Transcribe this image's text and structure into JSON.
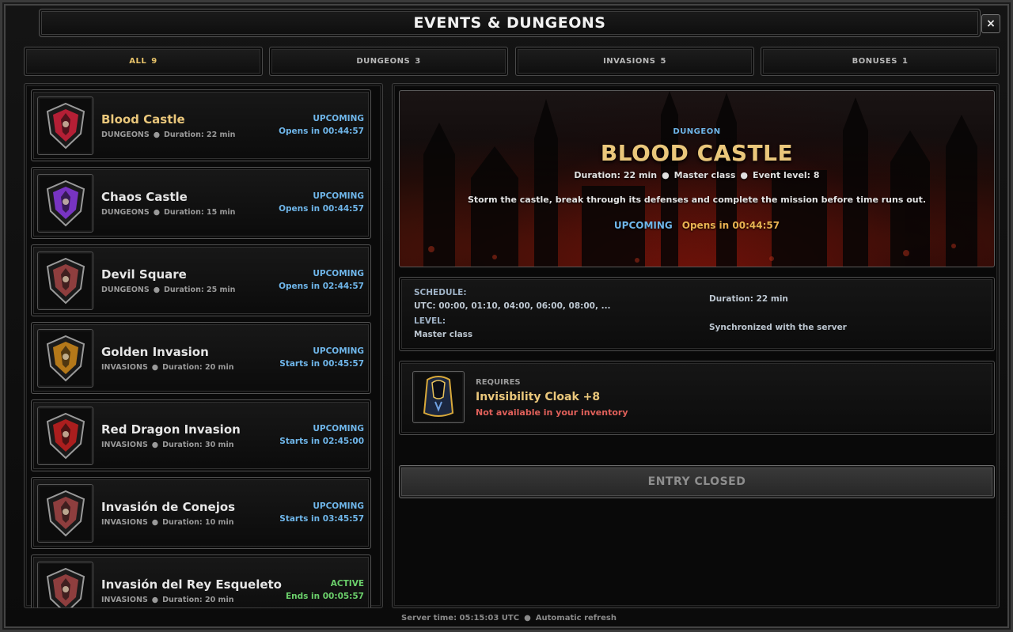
{
  "window": {
    "title": "EVENTS & DUNGEONS",
    "close_label": "×"
  },
  "tabs": [
    {
      "label": "ALL",
      "count": "9",
      "active": true
    },
    {
      "label": "DUNGEONS",
      "count": "3",
      "active": false
    },
    {
      "label": "INVASIONS",
      "count": "5",
      "active": false
    },
    {
      "label": "BONUSES",
      "count": "1",
      "active": false
    }
  ],
  "events": [
    {
      "name": "Blood Castle",
      "category": "DUNGEONS",
      "duration": "Duration: 22 min",
      "status": "UPCOMING",
      "timer": "Opens in 00:44:57",
      "icon": "blood-castle-crest-icon",
      "crest_color": "#d0213b",
      "selected": true
    },
    {
      "name": "Chaos Castle",
      "category": "DUNGEONS",
      "duration": "Duration: 15 min",
      "status": "UPCOMING",
      "timer": "Opens in 00:44:57",
      "icon": "chaos-castle-crest-icon",
      "crest_color": "#8a3ae0"
    },
    {
      "name": "Devil Square",
      "category": "DUNGEONS",
      "duration": "Duration: 25 min",
      "status": "UPCOMING",
      "timer": "Opens in 02:44:57",
      "icon": "devil-square-crest-icon",
      "crest_color": "#a34545"
    },
    {
      "name": "Golden Invasion",
      "category": "INVASIONS",
      "duration": "Duration: 20 min",
      "status": "UPCOMING",
      "timer": "Starts in 00:45:57",
      "icon": "golden-invasion-crest-icon",
      "crest_color": "#d08a1a"
    },
    {
      "name": "Red Dragon Invasion",
      "category": "INVASIONS",
      "duration": "Duration: 30 min",
      "status": "UPCOMING",
      "timer": "Starts in 02:45:00",
      "icon": "red-dragon-crest-icon",
      "crest_color": "#c52020"
    },
    {
      "name": "Invasión de Conejos",
      "category": "INVASIONS",
      "duration": "Duration: 10 min",
      "status": "UPCOMING",
      "timer": "Starts in 03:45:57",
      "icon": "rabbit-invasion-crest-icon",
      "crest_color": "#a34545"
    },
    {
      "name": "Invasión del Rey Esqueleto",
      "category": "INVASIONS",
      "duration": "Duration: 20 min",
      "status": "ACTIVE",
      "timer": "Ends in 00:05:57",
      "icon": "skeleton-king-crest-icon",
      "crest_color": "#a34545"
    }
  ],
  "detail": {
    "category": "DUNGEON",
    "title": "BLOOD CASTLE",
    "duration": "Duration: 22 min",
    "class_req": "Master class",
    "event_level": "Event level: 8",
    "description": "Storm the castle, break through its defenses and complete the mission before time runs out.",
    "status": "UPCOMING",
    "opens": "Opens in 00:44:57",
    "schedule_label": "SCHEDULE:",
    "schedule_value": "UTC: 00:00, 01:10, 04:00, 06:00, 08:00, ...",
    "level_label": "LEVEL:",
    "level_value": "Master class",
    "duration_right": "Duration: 22 min",
    "sync": "Synchronized with the server",
    "requires_label": "REQUIRES",
    "required_item": "Invisibility Cloak +8",
    "availability": "Not available in your inventory",
    "entry_button": "ENTRY CLOSED"
  },
  "footer": {
    "server_time": "Server time: 05:15:03 UTC",
    "refresh": "Automatic refresh"
  },
  "colors": {
    "gold": "#eac77b",
    "upcoming": "#6fb6ea",
    "active": "#6bd06b",
    "warning": "#e0605a"
  }
}
